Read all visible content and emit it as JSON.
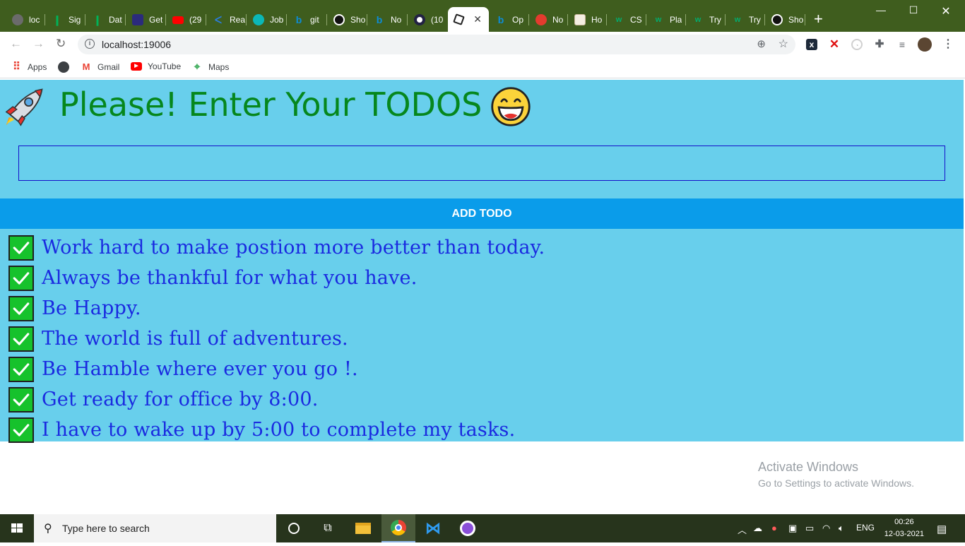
{
  "browser": {
    "tabs": [
      {
        "title": "loc",
        "icon": "globe-gray-icon",
        "color": "#6b6b6b"
      },
      {
        "title": "Sig",
        "icon": "mongodb-leaf-icon",
        "color": "#00b35a"
      },
      {
        "title": "Dat",
        "icon": "mongodb-leaf-icon",
        "color": "#00b35a"
      },
      {
        "title": "Get",
        "icon": "cube-icon",
        "color": "#2b2b7c"
      },
      {
        "title": "(29",
        "icon": "youtube-icon",
        "color": "#ff0000"
      },
      {
        "title": "Rea",
        "icon": "k-icon",
        "color": "#2a7de1"
      },
      {
        "title": "Job",
        "icon": "diamond-icon",
        "color": "#0bb7b7"
      },
      {
        "title": "git",
        "icon": "bing-icon",
        "color": "#0c8cd8"
      },
      {
        "title": "Sho",
        "icon": "github-icon",
        "color": "#111111"
      },
      {
        "title": "No",
        "icon": "bing-icon",
        "color": "#0c8cd8"
      },
      {
        "title": "(10",
        "icon": "dot-icon",
        "color": "#222244"
      }
    ],
    "active_tab": {
      "title": "",
      "icon": "cube-outline-icon"
    },
    "tabs_right": [
      {
        "title": "Op",
        "icon": "bing-icon",
        "color": "#0c8cd8"
      },
      {
        "title": "No",
        "icon": "bug-icon",
        "color": "#e33b2e"
      },
      {
        "title": "Ho",
        "icon": "page-icon",
        "color": "#e8e0d0"
      },
      {
        "title": "CS",
        "icon": "w3-icon",
        "color": "#04aa6d"
      },
      {
        "title": "Pla",
        "icon": "w3-icon",
        "color": "#04aa6d"
      },
      {
        "title": "Try",
        "icon": "w3-icon",
        "color": "#04aa6d"
      },
      {
        "title": "Try",
        "icon": "w3-icon",
        "color": "#04aa6d"
      },
      {
        "title": "Sho",
        "icon": "github-icon",
        "color": "#111111"
      }
    ],
    "url": "localhost:19006",
    "bookmarks": [
      {
        "label": "Apps",
        "icon": "apps-grid-icon"
      },
      {
        "label": "",
        "icon": "globe-icon"
      },
      {
        "label": "Gmail",
        "icon": "gmail-icon"
      },
      {
        "label": "YouTube",
        "icon": "youtube-icon"
      },
      {
        "label": "Maps",
        "icon": "maps-icon"
      }
    ]
  },
  "app": {
    "heading": "Please! Enter Your TODOS :",
    "heading_color": "#06871d",
    "input": {
      "value": "",
      "placeholder": ""
    },
    "add_button_label": "ADD TODO",
    "panel_color": "#68cfec",
    "button_color": "#0a9cea",
    "todo_text_color": "#1a2ae0",
    "todos": [
      "Work hard to make postion more better than today.",
      "Always be thankful for what you have.",
      "Be Happy.",
      "The world is full of adventures.",
      "Be Hamble where ever you go !.",
      "Get ready for office by 8:00.",
      "I have to wake up by 5:00 to complete my tasks."
    ]
  },
  "watermark": {
    "line1": "Activate Windows",
    "line2": "Go to Settings to activate Windows."
  },
  "taskbar": {
    "search_placeholder": "Type here to search",
    "language": "ENG",
    "time": "00:26",
    "date": "12-03-2021"
  }
}
